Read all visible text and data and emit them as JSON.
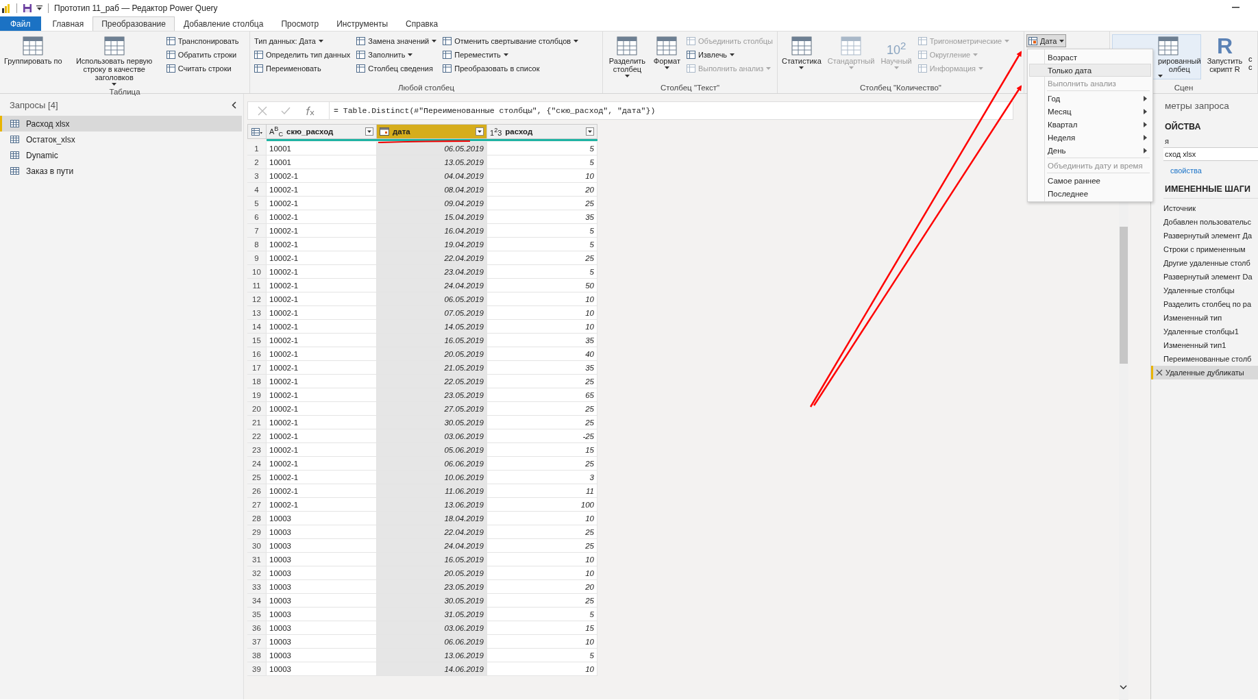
{
  "title_bar": {
    "title": "Прототип 11_раб — Редактор Power Query"
  },
  "tabs": [
    {
      "label": "Файл",
      "kind": "file",
      "selected": false
    },
    {
      "label": "Главная",
      "kind": "tab",
      "selected": false
    },
    {
      "label": "Преобразование",
      "kind": "tab",
      "selected": true
    },
    {
      "label": "Добавление столбца",
      "kind": "tab",
      "selected": false
    },
    {
      "label": "Просмотр",
      "kind": "tab",
      "selected": false
    },
    {
      "label": "Инструменты",
      "kind": "tab",
      "selected": false
    },
    {
      "label": "Справка",
      "kind": "tab",
      "selected": false
    }
  ],
  "ribbon": {
    "groups": [
      {
        "label": "Таблица",
        "columns": [
          [
            {
              "kind": "large",
              "label": "Группировать по",
              "dropdown": false,
              "disabled": false,
              "pressed": false
            }
          ],
          [
            {
              "kind": "large",
              "label": "Использовать первую строку в качестве заголовков",
              "dropdown": true,
              "disabled": false,
              "pressed": false
            }
          ],
          [
            {
              "kind": "small",
              "label": "Транспонировать",
              "dropdown": false,
              "disabled": false,
              "pressed": false
            },
            {
              "kind": "small",
              "label": "Обратить строки",
              "dropdown": false,
              "disabled": false,
              "pressed": false
            },
            {
              "kind": "small",
              "label": "Считать строки",
              "dropdown": false,
              "disabled": false,
              "pressed": false
            }
          ]
        ]
      },
      {
        "label": "Любой столбец",
        "columns": [
          [
            {
              "kind": "plain",
              "label": "Тип данных: Дата",
              "dropdown": true,
              "disabled": false,
              "pressed": false
            },
            {
              "kind": "small",
              "label": "Определить тип данных",
              "dropdown": false,
              "disabled": false,
              "pressed": false
            },
            {
              "kind": "small",
              "label": "Переименовать",
              "dropdown": false,
              "disabled": false,
              "pressed": false
            }
          ],
          [
            {
              "kind": "small",
              "label": "Замена значений",
              "dropdown": true,
              "disabled": false,
              "pressed": false
            },
            {
              "kind": "small",
              "label": "Заполнить",
              "dropdown": true,
              "disabled": false,
              "pressed": false
            },
            {
              "kind": "small",
              "label": "Столбец сведения",
              "dropdown": false,
              "disabled": false,
              "pressed": false
            }
          ],
          [
            {
              "kind": "small",
              "label": "Отменить свертывание столбцов",
              "dropdown": true,
              "disabled": false,
              "pressed": false
            },
            {
              "kind": "small",
              "label": "Переместить",
              "dropdown": true,
              "disabled": false,
              "pressed": false
            },
            {
              "kind": "small",
              "label": "Преобразовать в список",
              "dropdown": false,
              "disabled": false,
              "pressed": false
            }
          ]
        ]
      },
      {
        "label": "Столбец \"Текст\"",
        "columns": [
          [
            {
              "kind": "large",
              "label": "Разделить столбец",
              "dropdown": true,
              "disabled": false,
              "pressed": false
            }
          ],
          [
            {
              "kind": "large",
              "label": "Формат",
              "dropdown": true,
              "disabled": false,
              "pressed": false
            }
          ],
          [
            {
              "kind": "small",
              "label": "Объединить столбцы",
              "dropdown": false,
              "disabled": true,
              "pressed": false
            },
            {
              "kind": "small",
              "label": "Извлечь",
              "dropdown": true,
              "disabled": false,
              "pressed": false
            },
            {
              "kind": "small",
              "label": "Выполнить анализ",
              "dropdown": true,
              "disabled": true,
              "pressed": false
            }
          ]
        ]
      },
      {
        "label": "Столбец \"Количество\"",
        "columns": [
          [
            {
              "kind": "large",
              "label": "Статистика",
              "dropdown": true,
              "disabled": false,
              "pressed": false
            }
          ],
          [
            {
              "kind": "large",
              "label": "Стандартный",
              "dropdown": true,
              "disabled": true,
              "pressed": false
            }
          ],
          [
            {
              "kind": "large",
              "glyph": "10$^{2}$",
              "label": "Научный",
              "dropdown": true,
              "disabled": true,
              "pressed": false
            }
          ],
          [
            {
              "kind": "small",
              "label": "Тригонометрические",
              "dropdown": true,
              "disabled": true,
              "pressed": false
            },
            {
              "kind": "small",
              "label": "Округление",
              "dropdown": true,
              "disabled": true,
              "pressed": false
            },
            {
              "kind": "small",
              "label": "Информация",
              "dropdown": true,
              "disabled": true,
              "pressed": false
            }
          ]
        ]
      },
      {
        "columns": [
          [
            {
              "kind": "small",
              "label": "Дата",
              "dropdown": true,
              "disabled": false,
              "pressed": true
            }
          ]
        ]
      },
      {
        "label": "Сцен",
        "columns": [
          [
            {
              "kind": "large",
              "label": "рированный олбец",
              "dropdown": true,
              "disabled": false,
              "pressed": true
            }
          ],
          [
            {
              "kind": "large",
              "glyph": "R",
              "label": "Запустить скрипт R",
              "dropdown": false,
              "disabled": false,
              "pressed": false
            }
          ],
          [
            {
              "kind": "cut",
              "label": "с с"
            }
          ]
        ]
      }
    ]
  },
  "date_menu": {
    "items": [
      {
        "kind": "item",
        "label": "Возраст",
        "disabled": false,
        "submenu": false,
        "selected": false
      },
      {
        "kind": "item",
        "label": "Только дата",
        "disabled": false,
        "submenu": false,
        "selected": true
      },
      {
        "kind": "item",
        "label": "Выполнить анализ",
        "disabled": true,
        "submenu": false,
        "selected": false
      },
      {
        "kind": "separator"
      },
      {
        "kind": "item",
        "label": "Год",
        "disabled": false,
        "submenu": true,
        "selected": false
      },
      {
        "kind": "item",
        "label": "Месяц",
        "disabled": false,
        "submenu": true,
        "selected": false
      },
      {
        "kind": "item",
        "label": "Квартал",
        "disabled": false,
        "submenu": true,
        "selected": false
      },
      {
        "kind": "item",
        "label": "Неделя",
        "disabled": false,
        "submenu": true,
        "selected": false
      },
      {
        "kind": "item",
        "label": "День",
        "disabled": false,
        "submenu": true,
        "selected": false
      },
      {
        "kind": "separator"
      },
      {
        "kind": "item",
        "label": "Объединить дату и время",
        "disabled": true,
        "submenu": false,
        "selected": false
      },
      {
        "kind": "separator"
      },
      {
        "kind": "item",
        "label": "Самое раннее",
        "disabled": false,
        "submenu": false,
        "selected": false
      },
      {
        "kind": "item",
        "label": "Последнее",
        "disabled": false,
        "submenu": false,
        "selected": false
      }
    ]
  },
  "queries": {
    "title": "Запросы [4]",
    "items": [
      {
        "label": "Расход xlsx",
        "selected": true
      },
      {
        "label": "Остаток_xlsx",
        "selected": false
      },
      {
        "label": "Dynamic",
        "selected": false
      },
      {
        "label": "Заказ в пути",
        "selected": false
      }
    ]
  },
  "formula": "= Table.Distinct(#\"Переименованные столбцы\", {\"скю_расход\", \"дата\"})",
  "table": {
    "columns": [
      {
        "name": "скю_расход",
        "kind": "text",
        "type_mark": "A$^{B}$$_{C}$",
        "selected": false
      },
      {
        "name": "дата",
        "kind": "date",
        "selected": true
      },
      {
        "name": "расход",
        "kind": "number",
        "type_mark": "1$^{2}$3",
        "selected": false
      }
    ],
    "rows": [
      {
        "number": "1",
        "cells": [
          "10001",
          "06.05.2019",
          "5"
        ]
      },
      {
        "number": "2",
        "cells": [
          "10001",
          "13.05.2019",
          "5"
        ]
      },
      {
        "number": "3",
        "cells": [
          "10002-1",
          "04.04.2019",
          "10"
        ]
      },
      {
        "number": "4",
        "cells": [
          "10002-1",
          "08.04.2019",
          "20"
        ]
      },
      {
        "number": "5",
        "cells": [
          "10002-1",
          "09.04.2019",
          "25"
        ]
      },
      {
        "number": "6",
        "cells": [
          "10002-1",
          "15.04.2019",
          "35"
        ]
      },
      {
        "number": "7",
        "cells": [
          "10002-1",
          "16.04.2019",
          "5"
        ]
      },
      {
        "number": "8",
        "cells": [
          "10002-1",
          "19.04.2019",
          "5"
        ]
      },
      {
        "number": "9",
        "cells": [
          "10002-1",
          "22.04.2019",
          "25"
        ]
      },
      {
        "number": "10",
        "cells": [
          "10002-1",
          "23.04.2019",
          "5"
        ]
      },
      {
        "number": "11",
        "cells": [
          "10002-1",
          "24.04.2019",
          "50"
        ]
      },
      {
        "number": "12",
        "cells": [
          "10002-1",
          "06.05.2019",
          "10"
        ]
      },
      {
        "number": "13",
        "cells": [
          "10002-1",
          "07.05.2019",
          "10"
        ]
      },
      {
        "number": "14",
        "cells": [
          "10002-1",
          "14.05.2019",
          "10"
        ]
      },
      {
        "number": "15",
        "cells": [
          "10002-1",
          "16.05.2019",
          "35"
        ]
      },
      {
        "number": "16",
        "cells": [
          "10002-1",
          "20.05.2019",
          "40"
        ]
      },
      {
        "number": "17",
        "cells": [
          "10002-1",
          "21.05.2019",
          "35"
        ]
      },
      {
        "number": "18",
        "cells": [
          "10002-1",
          "22.05.2019",
          "25"
        ]
      },
      {
        "number": "19",
        "cells": [
          "10002-1",
          "23.05.2019",
          "65"
        ]
      },
      {
        "number": "20",
        "cells": [
          "10002-1",
          "27.05.2019",
          "25"
        ]
      },
      {
        "number": "21",
        "cells": [
          "10002-1",
          "30.05.2019",
          "25"
        ]
      },
      {
        "number": "22",
        "cells": [
          "10002-1",
          "03.06.2019",
          "-25"
        ]
      },
      {
        "number": "23",
        "cells": [
          "10002-1",
          "05.06.2019",
          "15"
        ]
      },
      {
        "number": "24",
        "cells": [
          "10002-1",
          "06.06.2019",
          "25"
        ]
      },
      {
        "number": "25",
        "cells": [
          "10002-1",
          "10.06.2019",
          "3"
        ]
      },
      {
        "number": "26",
        "cells": [
          "10002-1",
          "11.06.2019",
          "11"
        ]
      },
      {
        "number": "27",
        "cells": [
          "10002-1",
          "13.06.2019",
          "100"
        ]
      },
      {
        "number": "28",
        "cells": [
          "10003",
          "18.04.2019",
          "10"
        ]
      },
      {
        "number": "29",
        "cells": [
          "10003",
          "22.04.2019",
          "25"
        ]
      },
      {
        "number": "30",
        "cells": [
          "10003",
          "24.04.2019",
          "25"
        ]
      },
      {
        "number": "31",
        "cells": [
          "10003",
          "16.05.2019",
          "10"
        ]
      },
      {
        "number": "32",
        "cells": [
          "10003",
          "20.05.2019",
          "10"
        ]
      },
      {
        "number": "33",
        "cells": [
          "10003",
          "23.05.2019",
          "20"
        ]
      },
      {
        "number": "34",
        "cells": [
          "10003",
          "30.05.2019",
          "25"
        ]
      },
      {
        "number": "35",
        "cells": [
          "10003",
          "31.05.2019",
          "5"
        ]
      },
      {
        "number": "36",
        "cells": [
          "10003",
          "03.06.2019",
          "15"
        ]
      },
      {
        "number": "37",
        "cells": [
          "10003",
          "06.06.2019",
          "10"
        ]
      },
      {
        "number": "38",
        "cells": [
          "10003",
          "13.06.2019",
          "5"
        ]
      },
      {
        "number": "39",
        "cells": [
          "10003",
          "14.06.2019",
          "10"
        ]
      }
    ]
  },
  "settings": {
    "title": "метры запроса",
    "properties_heading": "ОЙСТВА",
    "name_label": "я",
    "name_value": "сход xlsx",
    "link": "свойства",
    "steps_heading": "ИМЕНЕННЫЕ ШАГИ",
    "steps": [
      {
        "label": "Источник",
        "selected": false
      },
      {
        "label": "Добавлен пользовательс",
        "selected": false
      },
      {
        "label": "Развернутый элемент Да",
        "selected": false
      },
      {
        "label": "Строки с примененным",
        "selected": false
      },
      {
        "label": "Другие удаленные столб",
        "selected": false
      },
      {
        "label": "Развернутый элемент Da",
        "selected": false
      },
      {
        "label": "Удаленные столбцы",
        "selected": false
      },
      {
        "label": "Разделить столбец по ра",
        "selected": false
      },
      {
        "label": "Измененный тип",
        "selected": false
      },
      {
        "label": "Удаленные столбцы1",
        "selected": false
      },
      {
        "label": "Измененный тип1",
        "selected": false
      },
      {
        "label": "Переименованные столб",
        "selected": false
      },
      {
        "label": "Удаленные дубликаты",
        "selected": true
      }
    ]
  }
}
